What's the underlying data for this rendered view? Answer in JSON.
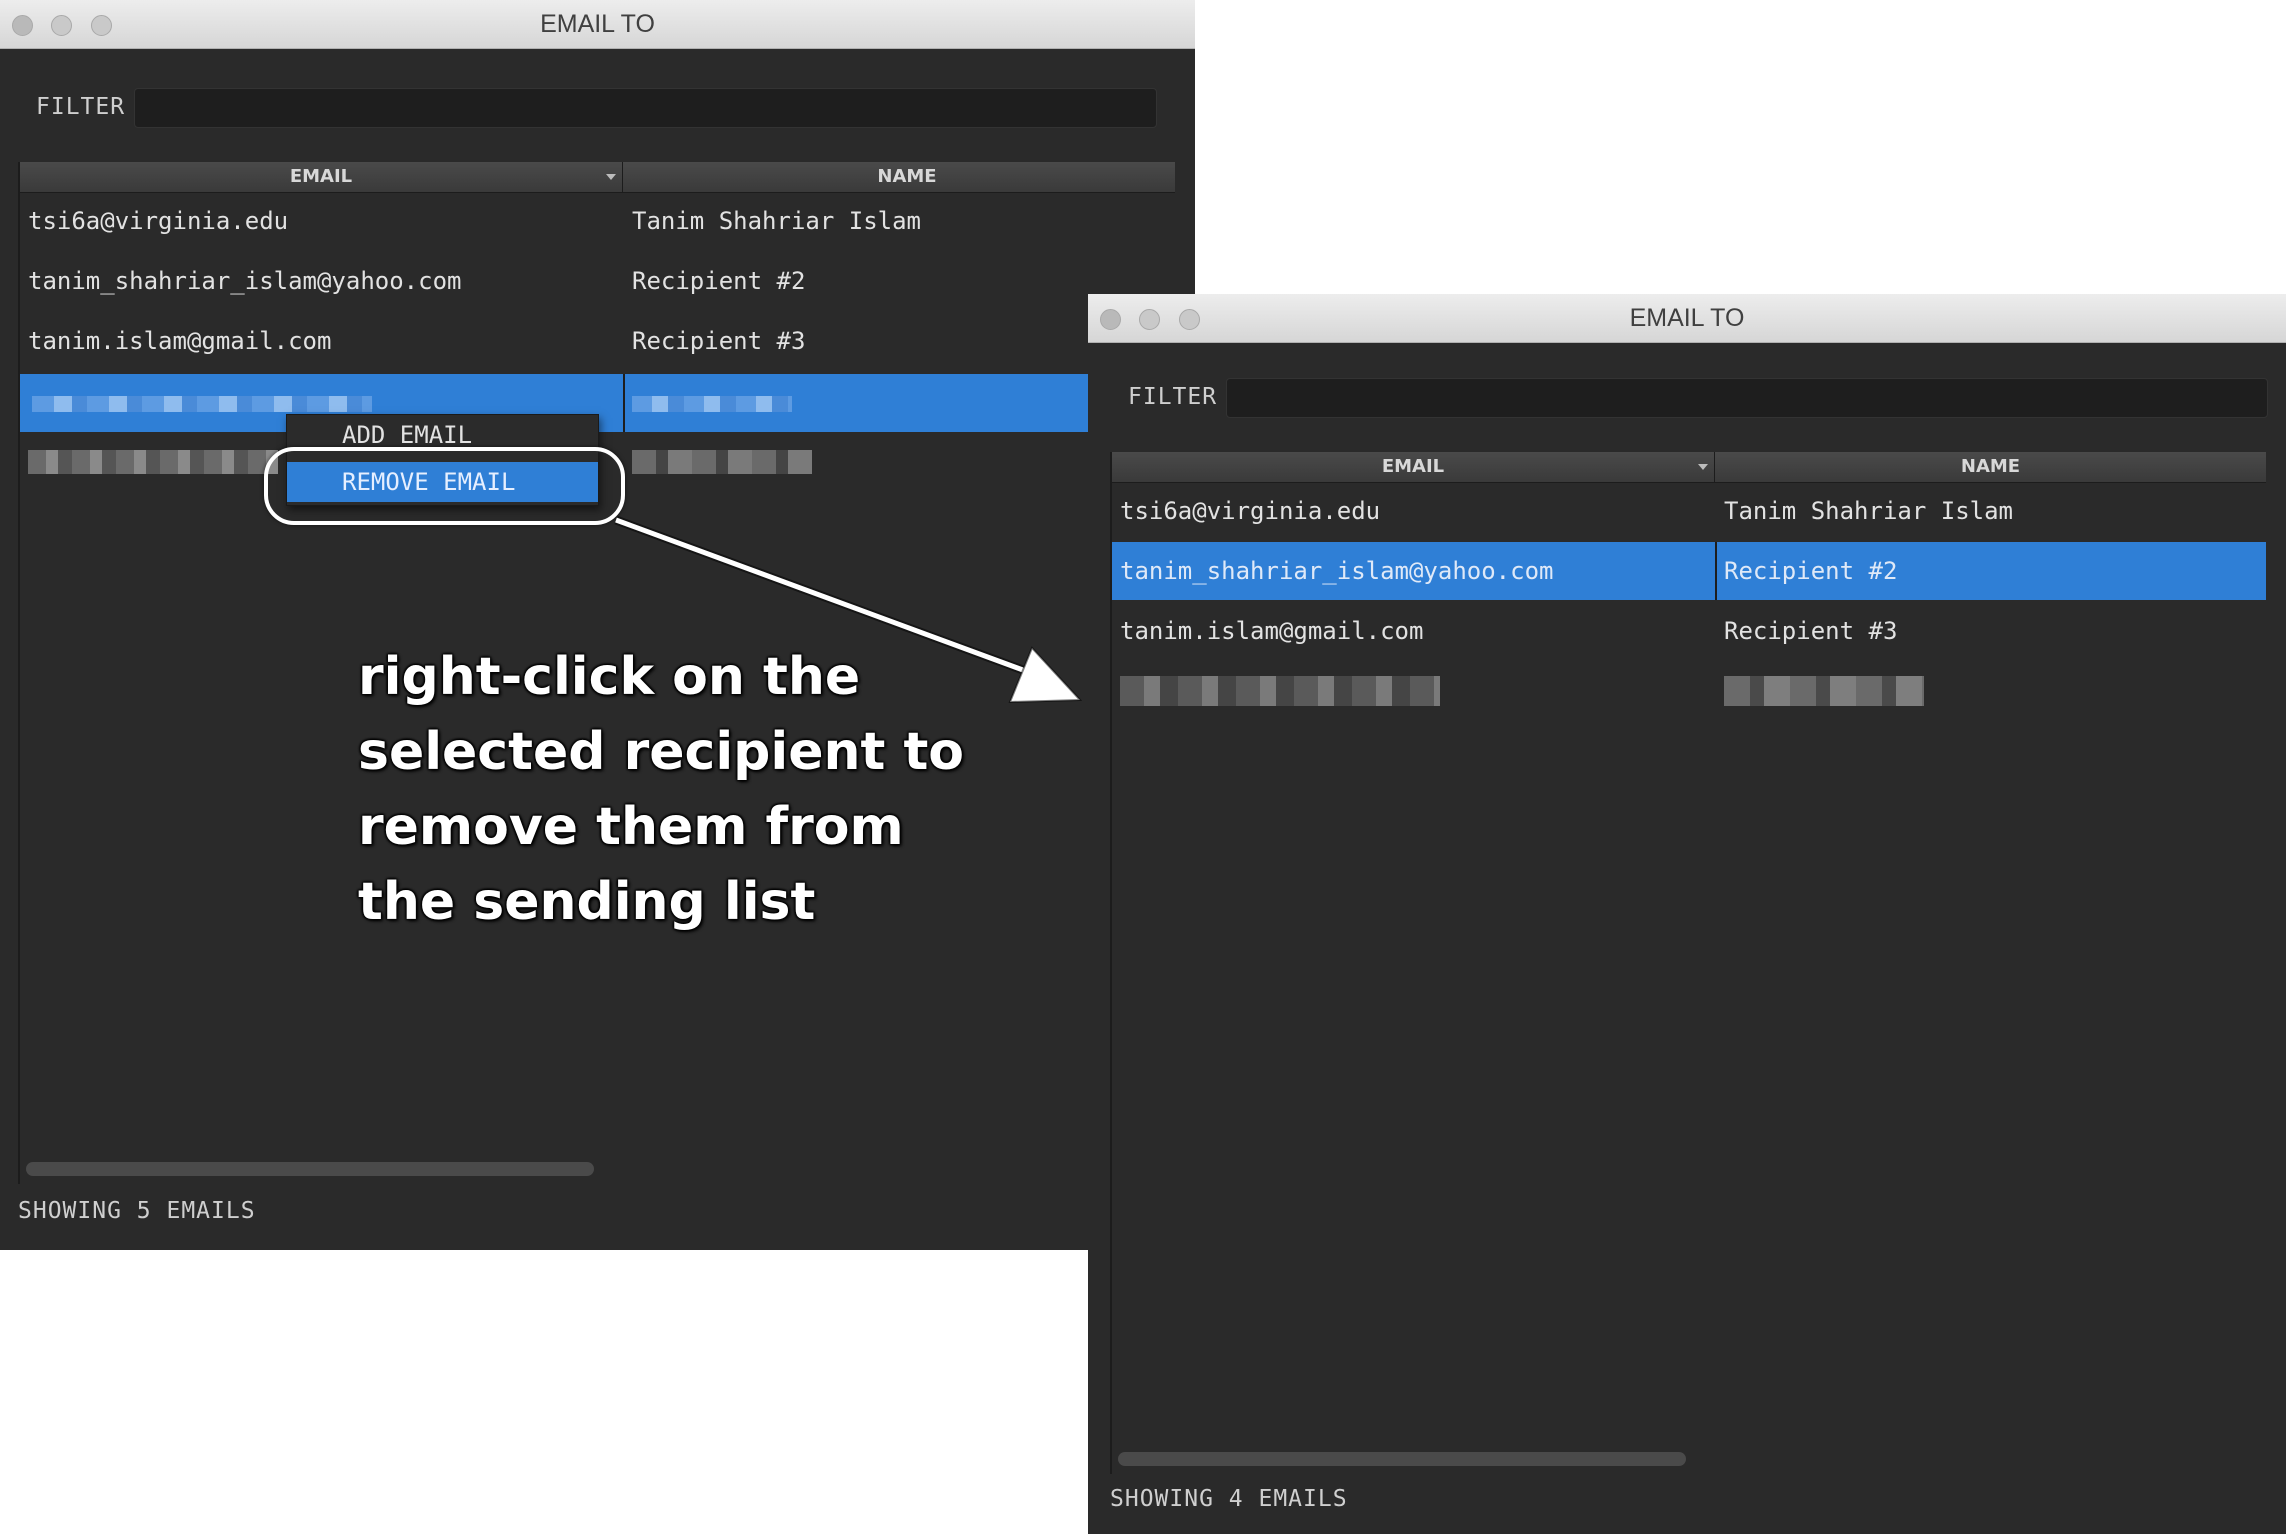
{
  "left_window": {
    "title": "EMAIL TO",
    "filter_label": "FILTER",
    "filter_value": "",
    "columns": {
      "email": "EMAIL",
      "name": "NAME"
    },
    "rows": [
      {
        "email": "tsi6a@virginia.edu",
        "name": "Tanim Shahriar Islam"
      },
      {
        "email": "tanim_shahriar_islam@yahoo.com",
        "name": "Recipient #2"
      },
      {
        "email": "tanim.islam@gmail.com",
        "name": "Recipient #3"
      }
    ],
    "context_menu": {
      "add": "ADD EMAIL",
      "remove": "REMOVE EMAIL"
    },
    "status": "SHOWING 5 EMAILS"
  },
  "right_window": {
    "title": "EMAIL TO",
    "filter_label": "FILTER",
    "filter_value": "",
    "columns": {
      "email": "EMAIL",
      "name": "NAME"
    },
    "rows": [
      {
        "email": "tsi6a@virginia.edu",
        "name": "Tanim Shahriar Islam"
      },
      {
        "email": "tanim_shahriar_islam@yahoo.com",
        "name": "Recipient #2"
      },
      {
        "email": "tanim.islam@gmail.com",
        "name": "Recipient #3"
      }
    ],
    "status": "SHOWING 4 EMAILS"
  },
  "annotation": {
    "lines": [
      "right-click on the",
      "selected recipient to",
      "remove them from",
      "the sending list"
    ]
  },
  "colors": {
    "selection": "#2f7fd6",
    "window_bg": "#2a2a2a",
    "annotation": "#ffffff"
  }
}
